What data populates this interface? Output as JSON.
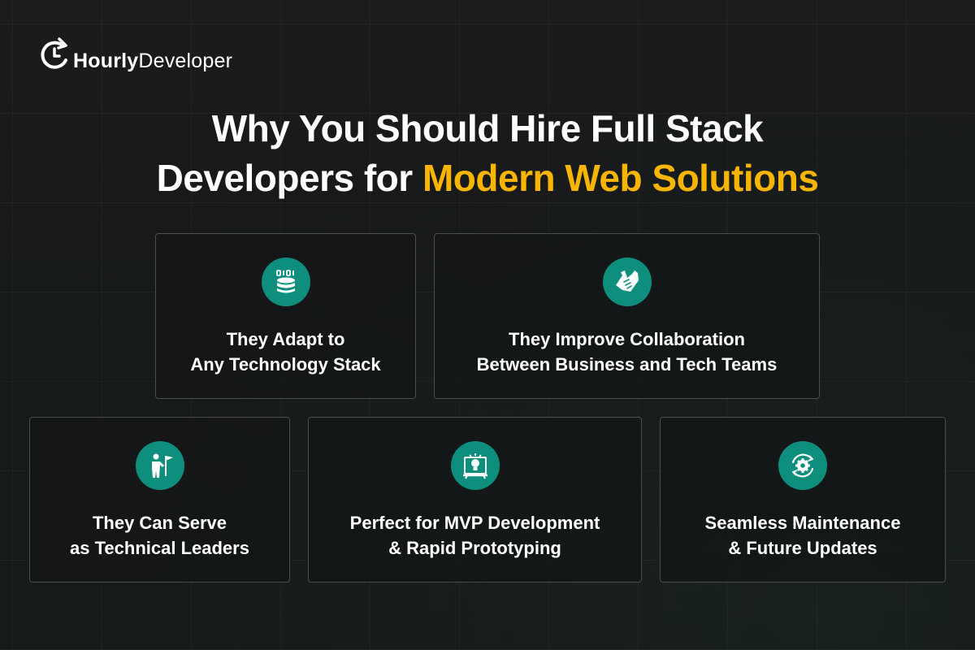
{
  "brand": {
    "name_bold": "Hourly",
    "name_regular": "Developer"
  },
  "heading": {
    "line1": "Why You Should Hire Full Stack",
    "line2_plain": "Developers for ",
    "line2_highlight": "Modern Web Solutions"
  },
  "colors": {
    "accent": "#f7b500",
    "icon_bg": "#0e8f7e",
    "background": "#121414",
    "card_border": "#4a4e50"
  },
  "cards": [
    {
      "icon": "database-stack-icon",
      "line1": "They Adapt to",
      "line2": "Any Technology Stack"
    },
    {
      "icon": "handshake-icon",
      "line1": "They Improve Collaboration",
      "line2": "Between Business and Tech Teams"
    },
    {
      "icon": "leader-flag-icon",
      "line1": "They Can Serve",
      "line2": "as Technical Leaders"
    },
    {
      "icon": "lightbulb-board-icon",
      "line1": "Perfect for MVP Development",
      "line2": "& Rapid Prototyping"
    },
    {
      "icon": "gear-refresh-icon",
      "line1": "Seamless Maintenance",
      "line2": "& Future Updates"
    }
  ]
}
